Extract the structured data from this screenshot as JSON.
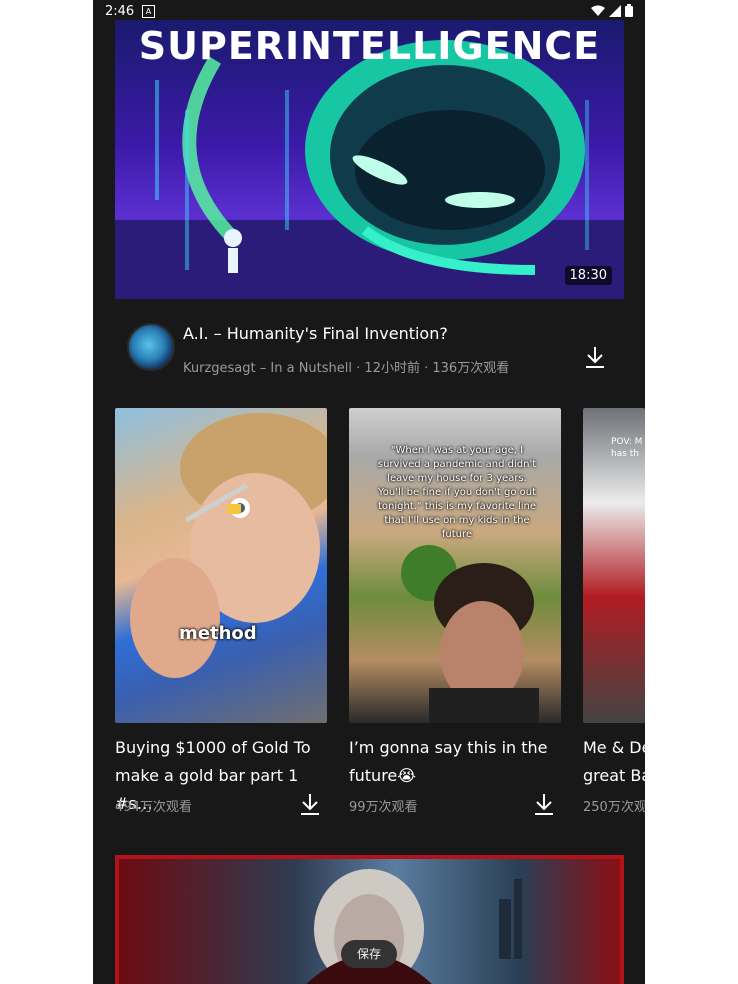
{
  "status_bar": {
    "time": "2:46",
    "badge": "A"
  },
  "hero": {
    "banner_text": "SUPERINTELLIGENCE",
    "duration": "18:30",
    "title": "A.I. – Humanity's Final Invention?",
    "channel": "Kurzgesagt – In a Nutshell",
    "age": "12小时前",
    "views": "136万次观看",
    "sep": "·"
  },
  "shorts": [
    {
      "overlay": "method",
      "title_line1": "Buying $1000 of Gold To",
      "title_line2": "make a gold bar part 1 #s…",
      "views": "494万次观看"
    },
    {
      "overlay_quote": "\"When I was at your age, I survived a pandemic and didn't leave my house for 3 years. You'll be fine if you don't go out tonight.\" this is my favorite line that I'll use on my kids in the future",
      "title_line1": "I’m gonna say this in the",
      "title_line2": "future😭",
      "views": "99万次观看"
    },
    {
      "overlay": "POV: M has th",
      "title_line1": "Me & De",
      "title_line2": "great Ba",
      "views": "250万次观"
    }
  ],
  "toast": {
    "label": "保存"
  },
  "icons": {
    "download": "download-icon",
    "wifi": "wifi-icon",
    "signal": "signal-icon",
    "battery": "battery-icon"
  }
}
